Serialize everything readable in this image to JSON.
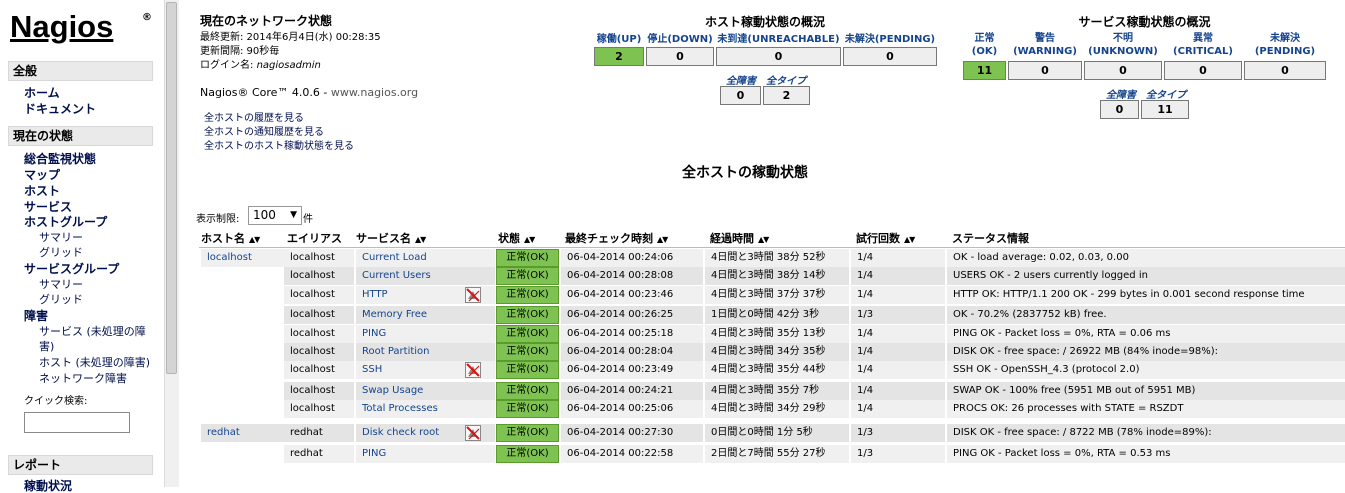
{
  "logo": {
    "text": "Nagios",
    "reg": "®"
  },
  "nav": {
    "general_header": "全般",
    "home": "ホーム",
    "documents": "ドキュメント",
    "current_header": "現在の状態",
    "tactical": "総合監視状態",
    "map": "マップ",
    "hosts": "ホスト",
    "services": "サービス",
    "hostgroups": "ホストグループ",
    "hg_summary": "サマリー",
    "hg_grid": "グリッド",
    "servicegroups": "サービスグループ",
    "sg_summary": "サマリー",
    "sg_grid": "グリッド",
    "problems": "障害",
    "svc_unhandled": "サービス (未処理の障害)",
    "host_unhandled": "ホスト (未処理の障害)",
    "network_outages": "ネットワーク障害",
    "quick_search": "クイック検索:",
    "reports_header": "レポート",
    "reports_item": "稼動状況"
  },
  "info": {
    "title": "現在のネットワーク状態",
    "last_updated": "最終更新: 2014年6月4日(水) 00:28:35",
    "interval": "更新間隔: 90秒毎",
    "logged_in_prefix": "ログイン名: ",
    "user": "nagiosadmin",
    "version_prefix": "Nagios® Core™ 4.0.6 - ",
    "version_link": "www.nagios.org",
    "links": [
      "全ホストの履歴を見る",
      "全ホストの通知履歴を見る",
      "全ホストのホスト稼動状態を見る"
    ]
  },
  "host_totals": {
    "title": "ホスト稼動状態の概況",
    "headers": [
      "稼働(UP)",
      "停止(DOWN)",
      "未到達(UNREACHABLE)",
      "未解決(PENDING)"
    ],
    "values": [
      "2",
      "0",
      "0",
      "0"
    ],
    "sub_headers": [
      "全障害",
      "全タイプ"
    ],
    "sub_values": [
      "0",
      "2"
    ]
  },
  "service_totals": {
    "title": "サービス稼動状態の概況",
    "headers": [
      [
        "正常",
        "(OK)"
      ],
      [
        "警告",
        "(WARNING)"
      ],
      [
        "不明",
        "(UNKNOWN)"
      ],
      [
        "異常",
        "(CRITICAL)"
      ],
      [
        "未解決",
        "(PENDING)"
      ]
    ],
    "values": [
      "11",
      "0",
      "0",
      "0",
      "0"
    ],
    "sub_headers": [
      "全障害",
      "全タイプ"
    ],
    "sub_values": [
      "0",
      "11"
    ]
  },
  "page_heading": "全ホストの稼動状態",
  "limit": {
    "label": "表示制限:",
    "value": "100",
    "unit": "件"
  },
  "table": {
    "columns": [
      "ホスト名",
      "エイリアス",
      "サービス名",
      "状態",
      "最終チェック時刻",
      "経過時間",
      "試行回数",
      "ステータス情報"
    ],
    "rows": [
      {
        "host": "localhost",
        "alias": "localhost",
        "service": "Current Load",
        "icon": false,
        "status": "正常(OK)",
        "last_check": "06-04-2014 00:24:06",
        "duration": "4日間と3時間 38分 52秒",
        "attempt": "1/4",
        "info": "OK - load average: 0.02, 0.03, 0.00"
      },
      {
        "host": "",
        "alias": "localhost",
        "service": "Current Users",
        "icon": false,
        "status": "正常(OK)",
        "last_check": "06-04-2014 00:28:08",
        "duration": "4日間と3時間 38分 14秒",
        "attempt": "1/4",
        "info": "USERS OK - 2 users currently logged in"
      },
      {
        "host": "",
        "alias": "localhost",
        "service": "HTTP",
        "icon": true,
        "status": "正常(OK)",
        "last_check": "06-04-2014 00:23:46",
        "duration": "4日間と3時間 37分 37秒",
        "attempt": "1/4",
        "info": "HTTP OK: HTTP/1.1 200 OK - 299 bytes in 0.001 second response time"
      },
      {
        "host": "",
        "alias": "localhost",
        "service": "Memory Free",
        "icon": false,
        "status": "正常(OK)",
        "last_check": "06-04-2014 00:26:25",
        "duration": "1日間と0時間 42分 3秒",
        "attempt": "1/3",
        "info": "OK - 70.2% (2837752 kB) free."
      },
      {
        "host": "",
        "alias": "localhost",
        "service": "PING",
        "icon": false,
        "status": "正常(OK)",
        "last_check": "06-04-2014 00:25:18",
        "duration": "4日間と3時間 35分 13秒",
        "attempt": "1/4",
        "info": "PING OK - Packet loss = 0%, RTA = 0.06 ms"
      },
      {
        "host": "",
        "alias": "localhost",
        "service": "Root Partition",
        "icon": false,
        "status": "正常(OK)",
        "last_check": "06-04-2014 00:28:04",
        "duration": "4日間と3時間 34分 35秒",
        "attempt": "1/4",
        "info": "DISK OK - free space: / 26922 MB (84% inode=98%):"
      },
      {
        "host": "",
        "alias": "localhost",
        "service": "SSH",
        "icon": true,
        "status": "正常(OK)",
        "last_check": "06-04-2014 00:23:49",
        "duration": "4日間と3時間 35分 44秒",
        "attempt": "1/4",
        "info": "SSH OK - OpenSSH_4.3 (protocol 2.0)"
      },
      {
        "host": "",
        "alias": "localhost",
        "service": "Swap Usage",
        "icon": false,
        "status": "正常(OK)",
        "last_check": "06-04-2014 00:24:21",
        "duration": "4日間と3時間 35分 7秒",
        "attempt": "1/4",
        "info": "SWAP OK - 100% free (5951 MB out of 5951 MB)"
      },
      {
        "host": "",
        "alias": "localhost",
        "service": "Total Processes",
        "icon": false,
        "status": "正常(OK)",
        "last_check": "06-04-2014 00:25:06",
        "duration": "4日間と3時間 34分 29秒",
        "attempt": "1/4",
        "info": "PROCS OK: 26 processes with STATE = RSZDT"
      },
      {
        "host": "redhat",
        "alias": "redhat",
        "service": "Disk check root",
        "icon": true,
        "status": "正常(OK)",
        "last_check": "06-04-2014 00:27:30",
        "duration": "0日間と0時間 1分 5秒",
        "attempt": "1/3",
        "info": "DISK OK - free space: / 8722 MB (78% inode=89%):"
      },
      {
        "host": "",
        "alias": "redhat",
        "service": "PING",
        "icon": false,
        "status": "正常(OK)",
        "last_check": "06-04-2014 00:22:58",
        "duration": "2日間と7時間 55分 27秒",
        "attempt": "1/3",
        "info": "PING OK - Packet loss = 0%, RTA = 0.53 ms"
      }
    ]
  }
}
